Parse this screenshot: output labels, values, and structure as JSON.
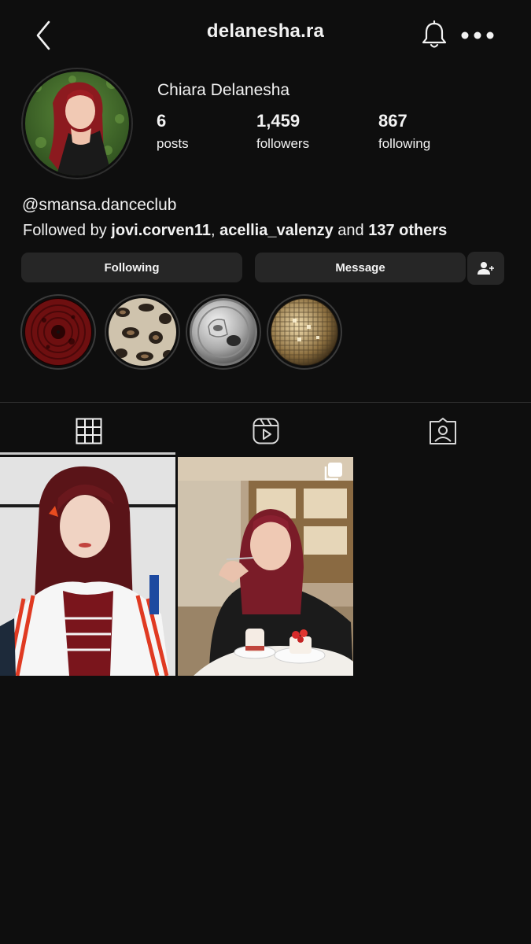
{
  "header": {
    "username": "delanesha.ra",
    "back_icon": "chevron-left-icon",
    "bell_icon": "bell-icon",
    "more_icon": "more-horizontal-icon"
  },
  "profile": {
    "display_name": "Chiara Delanesha",
    "stats": [
      {
        "value": "6",
        "label": "posts"
      },
      {
        "value": "1,459",
        "label": "followers"
      },
      {
        "value": "867",
        "label": "following"
      }
    ],
    "bio": "@smansa.danceclub",
    "followed_by": {
      "prefix": "Followed by ",
      "user1": "jovi.corven11",
      "sep": ", ",
      "user2": "acellia_valenzy",
      "and": " and ",
      "others": "137 others"
    }
  },
  "actions": {
    "following_label": "Following",
    "message_label": "Message",
    "add_user_icon": "person-add-icon"
  },
  "tabs": [
    {
      "icon": "grid-icon"
    },
    {
      "icon": "reels-icon"
    },
    {
      "icon": "tagged-icon"
    }
  ],
  "colors": {
    "background": "#0e0e0e",
    "button": "#262626",
    "text": "#f2f2f2"
  }
}
